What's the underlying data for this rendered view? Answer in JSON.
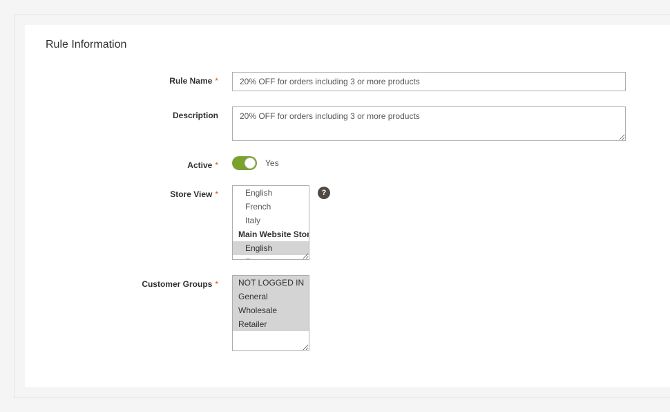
{
  "section_title": "Rule Information",
  "labels": {
    "rule_name": "Rule Name",
    "description": "Description",
    "active": "Active",
    "store_view": "Store View",
    "customer_groups": "Customer Groups"
  },
  "values": {
    "rule_name": "20% OFF for orders including 3 or more products",
    "description": "20% OFF for orders including 3 or more products",
    "active_text": "Yes"
  },
  "store_view": {
    "items": [
      {
        "label": "English",
        "selected": false,
        "bold": false,
        "indent": 1
      },
      {
        "label": "French",
        "selected": false,
        "bold": false,
        "indent": 1
      },
      {
        "label": "Italy",
        "selected": false,
        "bold": false,
        "indent": 1
      },
      {
        "label": "Main Website Store",
        "selected": false,
        "bold": true,
        "indent": 0
      },
      {
        "label": "English",
        "selected": true,
        "bold": false,
        "indent": 1
      },
      {
        "label": "French",
        "selected": false,
        "bold": false,
        "indent": 1
      }
    ]
  },
  "customer_groups": {
    "items": [
      {
        "label": "NOT LOGGED IN",
        "selected": true
      },
      {
        "label": "General",
        "selected": true
      },
      {
        "label": "Wholesale",
        "selected": true
      },
      {
        "label": "Retailer",
        "selected": true
      }
    ]
  },
  "help_icon_glyph": "?"
}
